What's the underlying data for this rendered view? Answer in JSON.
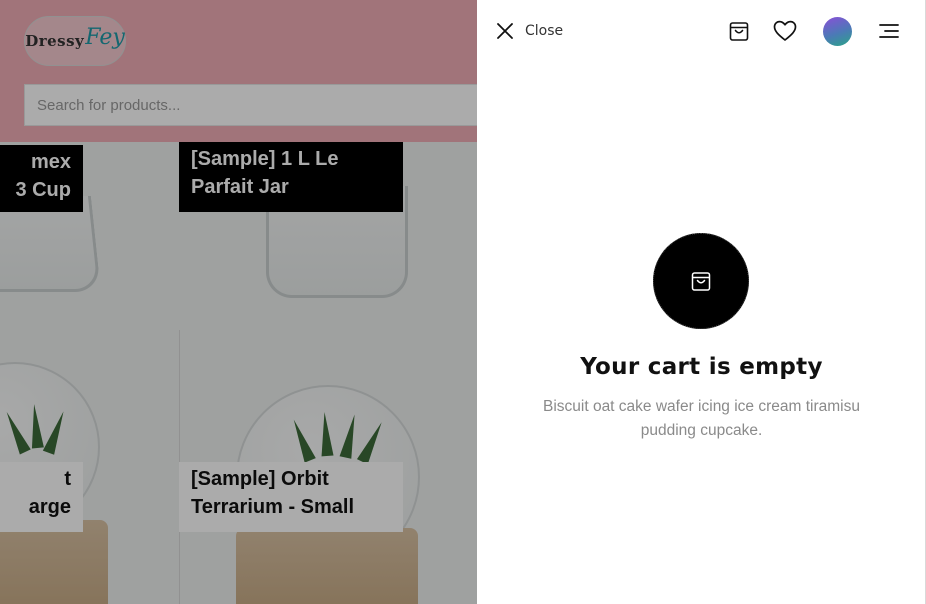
{
  "background": {
    "logo": {
      "part1": "Dressy",
      "part2": "Fey"
    },
    "search": {
      "placeholder": "Search for products..."
    },
    "products": [
      {
        "line1": "mex",
        "line2": "3 Cup"
      },
      {
        "line1": "[Sample] 1 L Le",
        "line2": "Parfait Jar"
      },
      {
        "line1": "t",
        "line2": "arge"
      },
      {
        "line1": "[Sample] Orbit",
        "line2": "Terrarium - Small"
      }
    ]
  },
  "drawer": {
    "close_label": "Close",
    "icons": [
      "close-icon",
      "shopping-bag-icon",
      "heart-icon",
      "avatar",
      "menu-icon"
    ],
    "empty_state": {
      "icon": "shopping-bag-icon",
      "title": "Your cart is empty",
      "description": "Biscuit oat cake wafer icing ice cream tiramisu pudding cupcake."
    }
  },
  "colors": {
    "header_pink": "#f0aeb6",
    "logo_accent": "#1f9aa8",
    "overlay": "rgba(0,0,0,0.33)",
    "avatar_gradient": [
      "#8a4fd8",
      "#4b7ab6",
      "#2aa488"
    ]
  }
}
